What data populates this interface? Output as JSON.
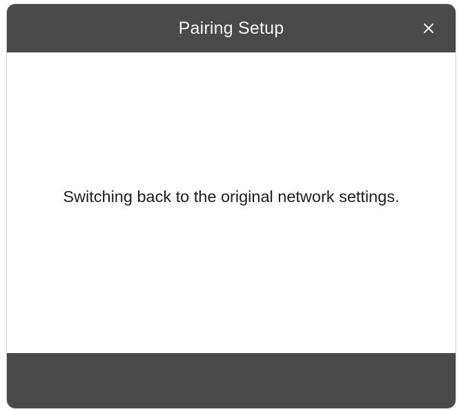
{
  "dialog": {
    "title": "Pairing Setup",
    "close_icon": "close-icon",
    "message": "Switching back to the original network settings."
  },
  "colors": {
    "header_background": "#4a4a4a",
    "footer_background": "#4a4a4a",
    "body_background": "#ffffff",
    "title_text": "#f4f4f4",
    "message_text": "#1e1e1e"
  }
}
